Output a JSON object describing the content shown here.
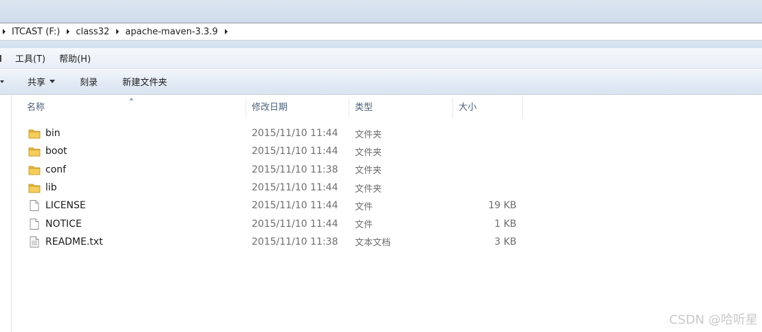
{
  "address": {
    "crumbs": [
      "ITCAST (F:)",
      "class32",
      "apache-maven-3.3.9"
    ]
  },
  "menu": {
    "tools": "工具(T)",
    "help": "帮助(H)"
  },
  "commands": {
    "share": "共享",
    "burn": "刻录",
    "new_folder": "新建文件夹"
  },
  "columns": {
    "name": "名称",
    "date": "修改日期",
    "type": "类型",
    "size": "大小"
  },
  "files": [
    {
      "name": "bin",
      "date": "2015/11/10 11:44",
      "type": "文件夹",
      "size": "",
      "icon": "folder-icon"
    },
    {
      "name": "boot",
      "date": "2015/11/10 11:44",
      "type": "文件夹",
      "size": "",
      "icon": "folder-icon"
    },
    {
      "name": "conf",
      "date": "2015/11/10 11:38",
      "type": "文件夹",
      "size": "",
      "icon": "folder-icon"
    },
    {
      "name": "lib",
      "date": "2015/11/10 11:44",
      "type": "文件夹",
      "size": "",
      "icon": "folder-icon"
    },
    {
      "name": "LICENSE",
      "date": "2015/11/10 11:44",
      "type": "文件",
      "size": "19 KB",
      "icon": "file-icon"
    },
    {
      "name": "NOTICE",
      "date": "2015/11/10 11:44",
      "type": "文件",
      "size": "1 KB",
      "icon": "file-icon"
    },
    {
      "name": "README.txt",
      "date": "2015/11/10 11:38",
      "type": "文本文档",
      "size": "3 KB",
      "icon": "text-file-icon"
    }
  ],
  "watermark": "CSDN @哈听星",
  "colors": {
    "folder": "#e8b83a",
    "header_text": "#4c607a",
    "meta_text": "#6d6d6d"
  }
}
